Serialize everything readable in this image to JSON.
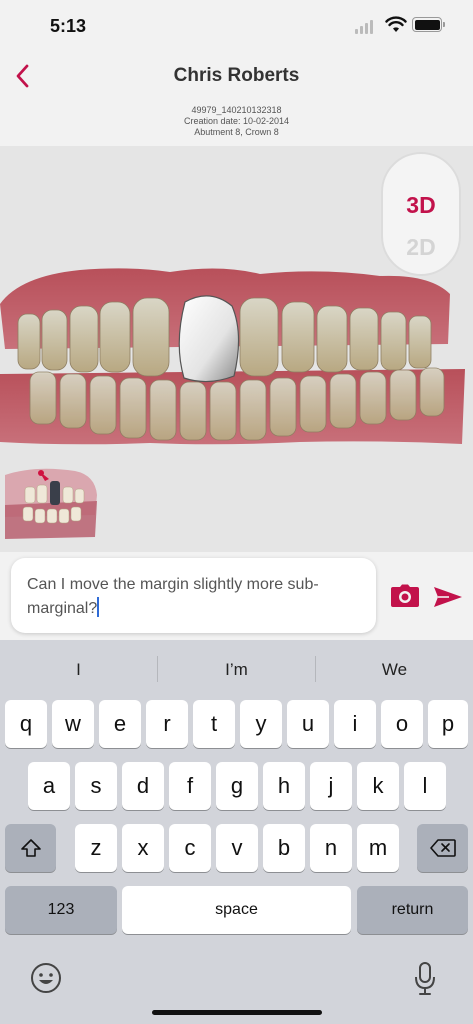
{
  "status_bar": {
    "time": "5:13",
    "icons": [
      "signal-icon",
      "wifi-icon",
      "battery-icon"
    ]
  },
  "header": {
    "back_icon": "chevron-left-icon",
    "title": "Chris Roberts",
    "case_id": "49979_140210132318",
    "creation_date": "Creation date: 10-02-2014",
    "details": "Abutment 8, Crown 8"
  },
  "viewer": {
    "mode_3d": "3D",
    "mode_2d": "2D",
    "active_mode": "3D"
  },
  "composer": {
    "message": "Can I move the margin slightly more sub-marginal?",
    "camera_icon": "camera-icon",
    "send_icon": "send-icon"
  },
  "keyboard": {
    "suggestions": [
      "I",
      "I’m",
      "We"
    ],
    "row1": [
      "q",
      "w",
      "e",
      "r",
      "t",
      "y",
      "u",
      "i",
      "o",
      "p"
    ],
    "row2": [
      "a",
      "s",
      "d",
      "f",
      "g",
      "h",
      "j",
      "k",
      "l"
    ],
    "row3": [
      "z",
      "x",
      "c",
      "v",
      "b",
      "n",
      "m"
    ],
    "numbers_label": "123",
    "space_label": "space",
    "return_label": "return",
    "shift_icon": "shift-icon",
    "delete_icon": "backspace-icon",
    "emoji_icon": "emoji-icon",
    "mic_icon": "microphone-icon"
  },
  "colors": {
    "accent": "#c2124b",
    "keyboard_bg": "#d2d4da",
    "key": "#ffffff",
    "key_dark": "#abb0ba"
  }
}
